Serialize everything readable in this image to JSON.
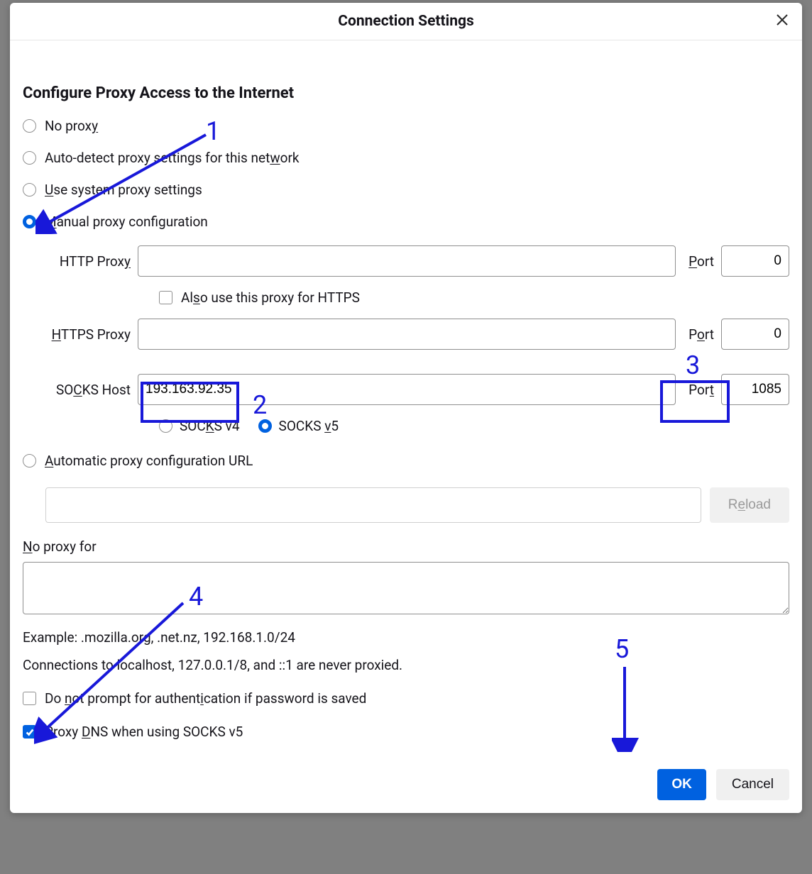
{
  "dialog": {
    "title": "Connection Settings",
    "section_title": "Configure Proxy Access to the Internet",
    "radios": {
      "no_proxy": "No proxy",
      "auto_detect": "Auto-detect proxy settings for this network",
      "use_system": "Use system proxy settings",
      "manual": "Manual proxy configuration",
      "auto_url": "Automatic proxy configuration URL"
    },
    "fields": {
      "http_proxy_label": "HTTP Proxy",
      "http_proxy_value": "",
      "http_port_label": "Port",
      "http_port_value": "0",
      "also_https_label": "Also use this proxy for HTTPS",
      "https_proxy_label": "HTTPS Proxy",
      "https_proxy_value": "",
      "https_port_label": "Port",
      "https_port_value": "0",
      "socks_host_label": "SOCKS Host",
      "socks_host_value": "193.163.92.35",
      "socks_port_label": "Port",
      "socks_port_value": "1085",
      "socks_v4_label": "SOCKS v4",
      "socks_v5_label": "SOCKS v5",
      "reload_label": "Reload",
      "no_proxy_for_label": "No proxy for",
      "example_text": "Example: .mozilla.org, .net.nz, 192.168.1.0/24",
      "localhost_text": "Connections to localhost, 127.0.0.1/8, and ::1 are never proxied.",
      "auth_prompt_label": "Do not prompt for authentication if password is saved",
      "proxy_dns_label": "Proxy DNS when using SOCKS v5"
    },
    "buttons": {
      "ok": "OK",
      "cancel": "Cancel"
    }
  },
  "annotations": {
    "n1": "1",
    "n2": "2",
    "n3": "3",
    "n4": "4",
    "n5": "5"
  }
}
